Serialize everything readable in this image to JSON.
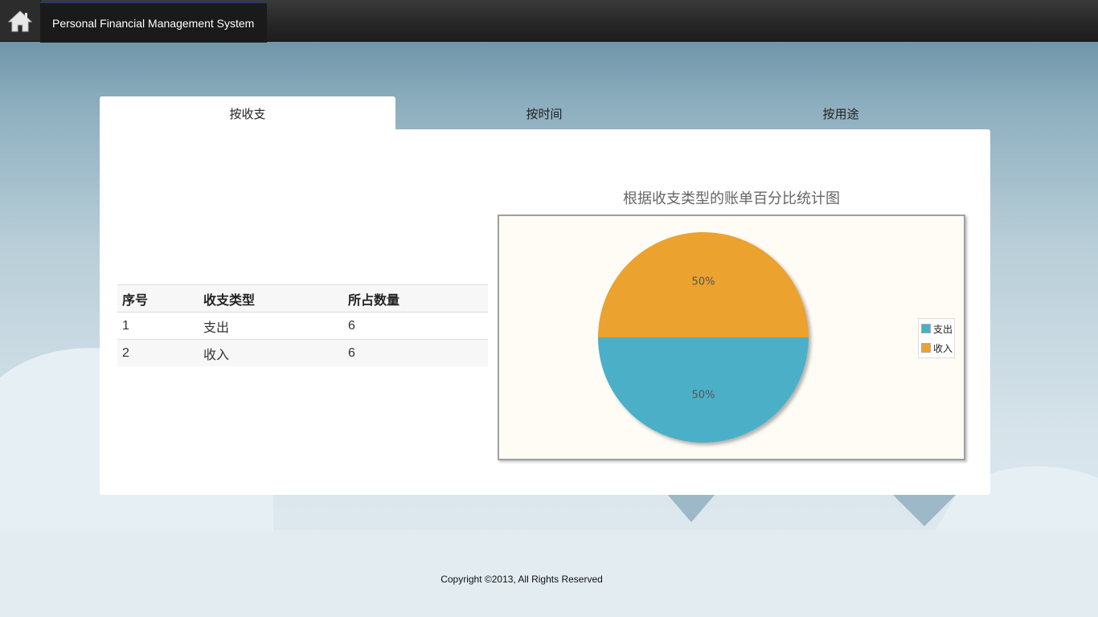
{
  "app": {
    "title": "Personal Financial Management System"
  },
  "tabs": [
    {
      "label": "按收支",
      "active": true
    },
    {
      "label": "按时间",
      "active": false
    },
    {
      "label": "按用途",
      "active": false
    }
  ],
  "table": {
    "headers": [
      "序号",
      "收支类型",
      "所占数量"
    ],
    "rows": [
      [
        "1",
        "支出",
        "6"
      ],
      [
        "2",
        "收入",
        "6"
      ]
    ]
  },
  "chart_data": {
    "type": "pie",
    "title": "根据收支类型的账单百分比统计图",
    "slices": [
      {
        "label": "支出",
        "value": 50,
        "display": "50%",
        "color": "#4bb0c7"
      },
      {
        "label": "收入",
        "value": 50,
        "display": "50%",
        "color": "#eba22e"
      }
    ],
    "legend_position": "right"
  },
  "footer": {
    "text": "Copyright ©2013, All Rights Reserved"
  },
  "icons": {
    "home": "home-icon"
  }
}
